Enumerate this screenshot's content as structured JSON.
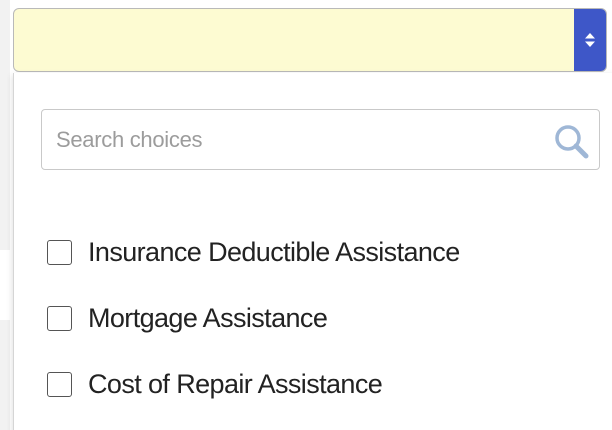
{
  "select": {
    "current_value": "",
    "arrow_icon": "up-down-caret-icon",
    "background_color": "#fdfbd2",
    "accent_color": "#3e57c8"
  },
  "dropdown": {
    "search": {
      "placeholder": "Search choices",
      "value": "",
      "icon": "search-icon",
      "icon_color": "#9fb7d6"
    },
    "options": [
      {
        "label": "Insurance Deductible Assistance",
        "checked": false
      },
      {
        "label": "Mortgage Assistance",
        "checked": false
      },
      {
        "label": "Cost of Repair Assistance",
        "checked": false
      }
    ]
  }
}
